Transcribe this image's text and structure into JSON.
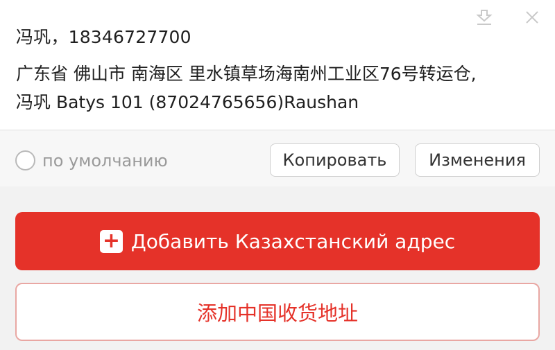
{
  "address_card": {
    "name_phone": "冯巩，18346727700",
    "address_line1": "广东省 佛山市 南海区 里水镇草场海南州工业区76号转运仓,",
    "address_line2": "冯巩 Batys 101 (87024765656)Raushan",
    "icons": {
      "download": "download-icon",
      "close": "close-icon"
    }
  },
  "actions": {
    "default_label": "по умолчанию",
    "copy_label": "Копировать",
    "edit_label": "Изменения"
  },
  "buttons": {
    "add_kz_label": "Добавить Казахстанский адрес",
    "add_cn_label": "添加中国收货地址"
  },
  "colors": {
    "accent": "#e53229",
    "outline_border": "#e9a7a3",
    "muted_text": "#9a9a9a"
  }
}
